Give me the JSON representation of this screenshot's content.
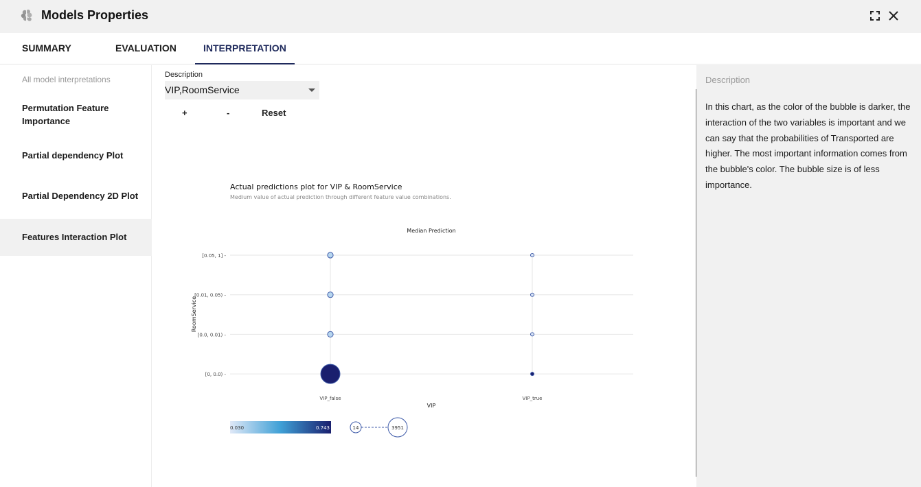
{
  "window": {
    "title": "Models Properties",
    "logo_icon": "brain-icon",
    "expand_icon": "expand-icon",
    "close_icon": "close-icon"
  },
  "tabs": [
    {
      "label": "SUMMARY",
      "active": false
    },
    {
      "label": "EVALUATION",
      "active": false
    },
    {
      "label": "INTERPRETATION",
      "active": true
    }
  ],
  "sidebar": {
    "caption": "All model interpretations",
    "items": [
      {
        "label": "Permutation Feature Importance",
        "active": false
      },
      {
        "label": "Partial dependency Plot",
        "active": false
      },
      {
        "label": "Partial Dependency 2D Plot",
        "active": false
      },
      {
        "label": "Features Interaction Plot",
        "active": true
      }
    ]
  },
  "controls": {
    "description_label": "Description",
    "selected": "VIP,RoomService",
    "zoom_in": "+",
    "zoom_out": "-",
    "reset": "Reset"
  },
  "chart_data": {
    "type": "scatter",
    "title": "Actual predictions plot for VIP & RoomService",
    "subtitle": "Medium value of actual prediction through different feature value combinations.",
    "legend_title": "Median Prediction",
    "xlabel": "VIP",
    "ylabel": "RoomService",
    "x_categories": [
      "VIP_false",
      "VIP_true"
    ],
    "y_categories": [
      "[0, 0.0)",
      "[0.0, 0.01)",
      "[0.01, 0.05)",
      "[0.05, 1]"
    ],
    "points": [
      {
        "x": "VIP_false",
        "y": "[0.05, 1]",
        "prediction": 0.12,
        "count": 90
      },
      {
        "x": "VIP_false",
        "y": "[0.01, 0.05)",
        "prediction": 0.12,
        "count": 90
      },
      {
        "x": "VIP_false",
        "y": "[0.0, 0.01)",
        "prediction": 0.12,
        "count": 90
      },
      {
        "x": "VIP_false",
        "y": "[0, 0.0)",
        "prediction": 0.743,
        "count": 3951
      },
      {
        "x": "VIP_true",
        "y": "[0.05, 1]",
        "prediction": 0.04,
        "count": 14
      },
      {
        "x": "VIP_true",
        "y": "[0.01, 0.05)",
        "prediction": 0.04,
        "count": 14
      },
      {
        "x": "VIP_true",
        "y": "[0.0, 0.01)",
        "prediction": 0.04,
        "count": 14
      },
      {
        "x": "VIP_true",
        "y": "[0, 0.0)",
        "prediction": 0.743,
        "count": 14
      }
    ],
    "color_scale": {
      "min": 0.03,
      "max": 0.743,
      "min_label": "0.030",
      "max_label": "0.743",
      "colors": [
        "#dfe8f7",
        "#3fa0d6",
        "#1a1f6e"
      ]
    },
    "size_scale": {
      "min": 14,
      "max": 3951,
      "min_label": "14",
      "max_label": "3951"
    },
    "grid": true
  },
  "description": {
    "caption": "Description",
    "text": "In this chart, as the color of the bubble is darker, the interaction of the two variables is important and we can say that the probabilities of Transported are higher. The most important information comes from the bubble's color. The bubble size is of less importance."
  }
}
